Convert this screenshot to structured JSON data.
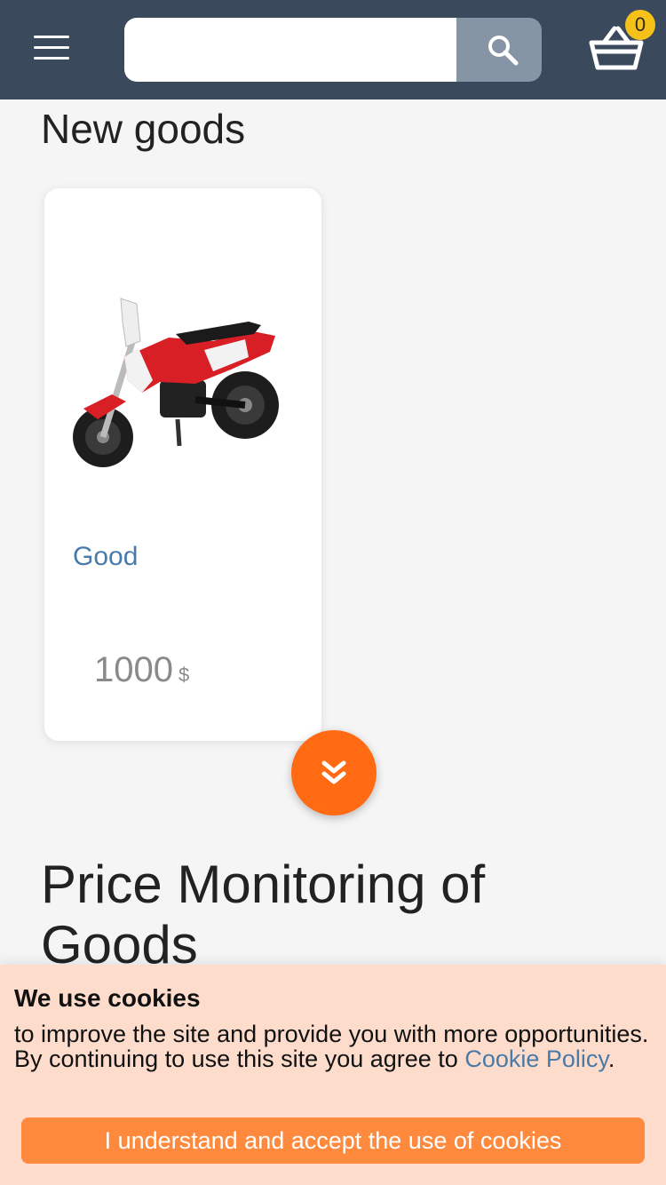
{
  "header": {
    "search": {
      "value": "",
      "placeholder": ""
    },
    "cart": {
      "count": "0"
    },
    "icons": {
      "menu": "hamburger-menu-icon",
      "search": "magnifier-icon",
      "cart": "basket-icon"
    },
    "colors": {
      "background": "#3a4a5c",
      "search_button": "#8595a6",
      "badge": "#f6c21a"
    }
  },
  "new_goods": {
    "title": "New goods",
    "products": [
      {
        "name": "Good",
        "price": "1000",
        "currency": "$",
        "image": "red-dirt-bike-motorcycle"
      }
    ],
    "show_more_icon": "double-chevron-down-icon",
    "accent_color": "#ff6a13"
  },
  "price_monitoring": {
    "title": "Price Monitoring of Goods"
  },
  "cookie_banner": {
    "title": "We use cookies",
    "text": "to improve the site and provide you with more opportunities. By continuing to use this site you agree to",
    "link_label": "Cookie Policy",
    "period": ".",
    "accept_label": "I understand and accept the use of cookies",
    "colors": {
      "background": "#fddccc",
      "button": "#ff8a3d",
      "link": "#4a7aa8"
    }
  }
}
